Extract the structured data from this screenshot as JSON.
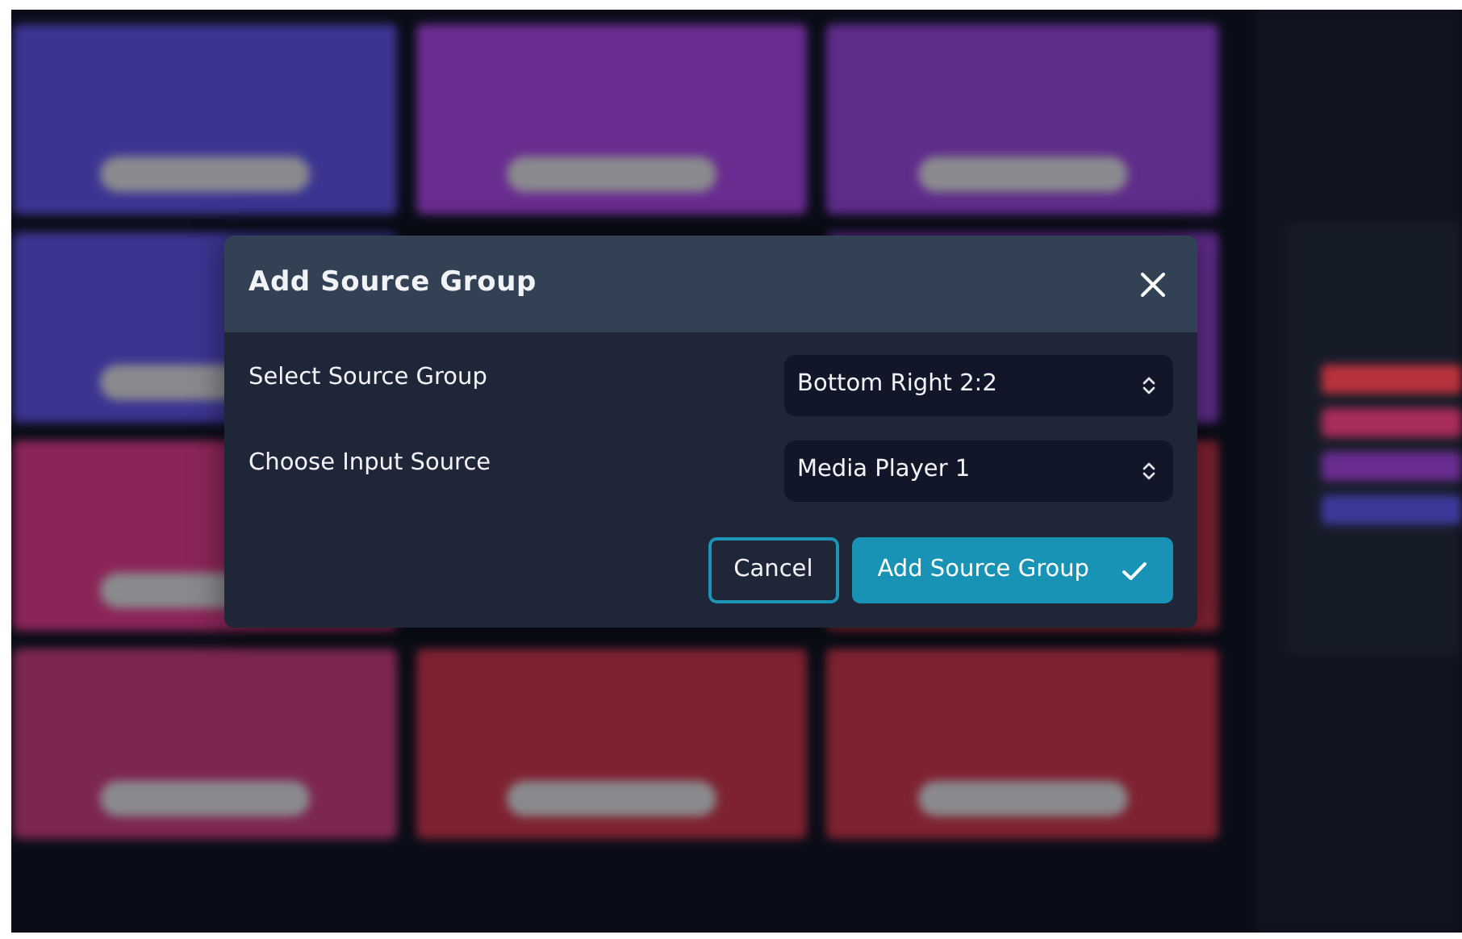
{
  "background": {
    "tile_rows": [
      [
        {
          "color": "#3b3591"
        },
        {
          "color": "#6a2c90"
        },
        {
          "color": "#5f2c8b"
        }
      ],
      [
        {
          "color": "#3b3591"
        },
        {
          "color": "#5f2c8b"
        }
      ],
      [
        {
          "color": "#8b2558"
        },
        {
          "color": "#7e2230"
        }
      ],
      [
        {
          "color": "#7d2652"
        },
        {
          "color": "#7e2230"
        },
        {
          "color": "#7e2230"
        }
      ]
    ],
    "side_bars": [
      {
        "color": "#b8323c"
      },
      {
        "color": "#a82c5a"
      },
      {
        "color": "#6a2c90"
      },
      {
        "color": "#3b3a9a"
      }
    ]
  },
  "modal": {
    "title": "Add Source Group",
    "fields": [
      {
        "label": "Select Source Group",
        "value": "Bottom Right 2:2"
      },
      {
        "label": "Choose Input Source",
        "value": "Media Player 1"
      }
    ],
    "buttons": [
      {
        "kind": "cancel",
        "label": "Cancel"
      },
      {
        "kind": "confirm",
        "label": "Add Source Group"
      }
    ]
  }
}
